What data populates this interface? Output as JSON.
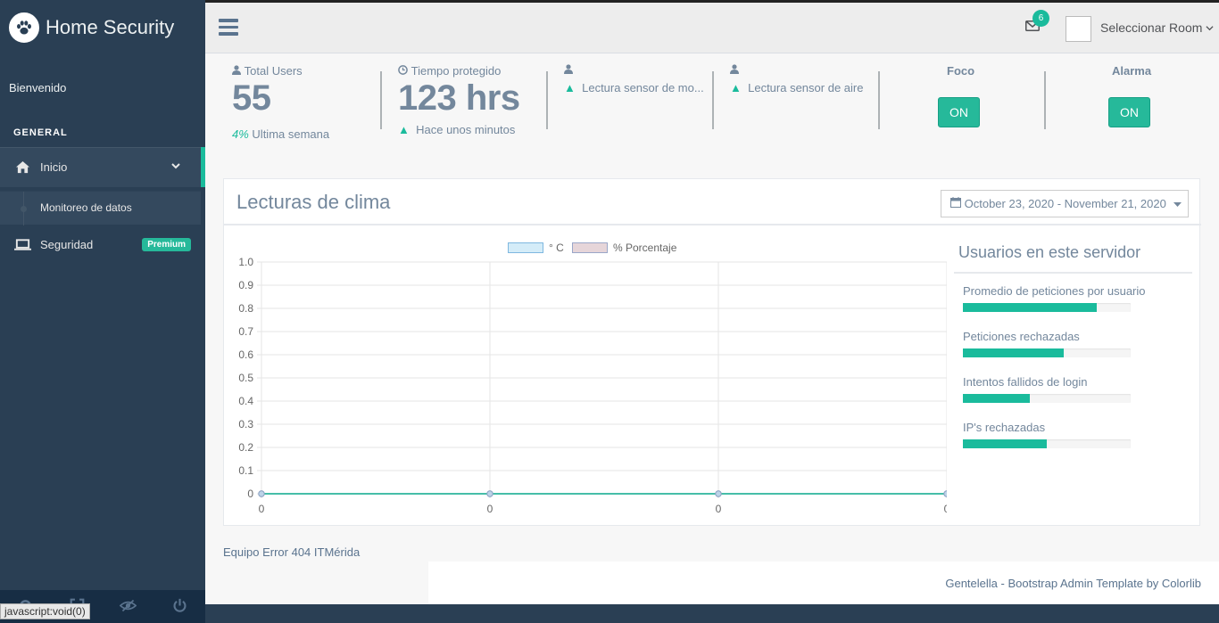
{
  "brand": {
    "title": "Home Security",
    "icon": "paw-icon"
  },
  "sidebar": {
    "welcome": "Bienvenido",
    "section_title": "GENERAL",
    "items": [
      {
        "label": "Inicio",
        "icon": "home-icon"
      },
      {
        "label": "Monitoreo de datos"
      },
      {
        "label": "Seguridad",
        "icon": "laptop-icon",
        "badge": "Premium"
      }
    ],
    "footer_icons": [
      "settings-icon",
      "fullscreen-icon",
      "eye-slash-icon",
      "power-icon"
    ]
  },
  "status_bar": "javascript:void(0)",
  "topnav": {
    "mail_count": "6",
    "room_label": "Seleccionar Room"
  },
  "tiles": {
    "users": {
      "label": "Total Users",
      "value": "55",
      "sub_pct": "4%",
      "sub_text": "Ultima semana"
    },
    "time": {
      "label": "Tiempo protegido",
      "value": "123 hrs",
      "sub_text": "Hace unos minutos"
    },
    "sensor1": {
      "sub_text": "Lectura sensor de mo..."
    },
    "sensor2": {
      "sub_text": "Lectura sensor de aire"
    },
    "foco": {
      "title": "Foco",
      "button": "ON"
    },
    "alarma": {
      "title": "Alarma",
      "button": "ON"
    }
  },
  "panel": {
    "title": "Lecturas de clima",
    "daterange": "October 23, 2020 - November 21, 2020"
  },
  "chart_data": {
    "type": "line",
    "x": [
      0,
      0,
      0,
      0
    ],
    "series": [
      {
        "name": "° C",
        "values": [
          0,
          0,
          0,
          0
        ],
        "color": "#1ABB9C"
      },
      {
        "name": "% Porcentaje",
        "values": [
          0,
          0,
          0,
          0
        ],
        "color": "#9B8FA0"
      }
    ],
    "ylim": [
      0,
      1
    ],
    "yticks": [
      "1.0",
      "0.9",
      "0.8",
      "0.7",
      "0.6",
      "0.5",
      "0.4",
      "0.3",
      "0.2",
      "0.1",
      "0"
    ],
    "xticks": [
      "0",
      "0",
      "0",
      "0"
    ],
    "legend": "top",
    "grid": true
  },
  "server": {
    "title": "Usuarios en este servidor",
    "items": [
      {
        "label": "Promedio de peticiones por usuario",
        "pct": 80
      },
      {
        "label": "Peticiones rechazadas",
        "pct": 60
      },
      {
        "label": "Intentos fallidos de login",
        "pct": 40
      },
      {
        "label": "IP's rechazadas",
        "pct": 50
      }
    ]
  },
  "footer": {
    "team": "Equipo Error 404 ITMérida",
    "credit": "Gentelella - Bootstrap Admin Template by Colorlib"
  }
}
